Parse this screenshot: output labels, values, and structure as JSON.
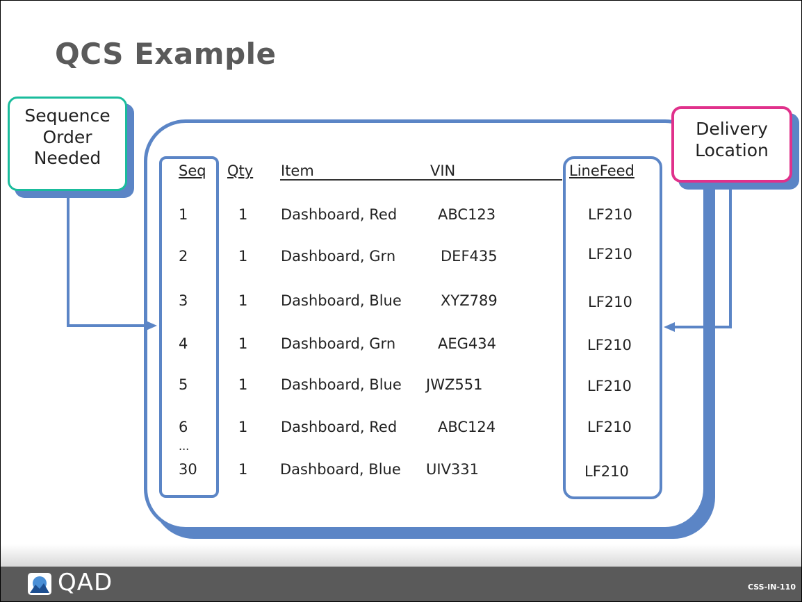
{
  "slide": {
    "title": "QCS Example",
    "callouts": {
      "sequence": [
        "Sequence",
        "Order",
        "Needed"
      ],
      "delivery": [
        "Delivery",
        "Location"
      ]
    },
    "table": {
      "headers": {
        "seq": "Seq",
        "qty": "Qty",
        "item": "Item",
        "vin": "VIN",
        "linefeed": "LineFeed"
      },
      "rows": [
        {
          "seq": "1",
          "qty": "1",
          "item": "Dashboard, Red",
          "vin": "ABC123",
          "linefeed": "LF210"
        },
        {
          "seq": "2",
          "qty": "1",
          "item": "Dashboard, Grn",
          "vin": "DEF435",
          "linefeed": "LF210"
        },
        {
          "seq": "3",
          "qty": "1",
          "item": "Dashboard, Blue",
          "vin": "XYZ789",
          "linefeed": "LF210"
        },
        {
          "seq": "4",
          "qty": "1",
          "item": "Dashboard, Grn",
          "vin": "AEG434",
          "linefeed": "LF210"
        },
        {
          "seq": "5",
          "qty": "1",
          "item": "Dashboard, Blue",
          "vin": "JWZ551",
          "linefeed": "LF210"
        },
        {
          "seq": "6",
          "qty": "1",
          "item": "Dashboard, Red",
          "vin": "ABC124",
          "linefeed": "LF210"
        },
        {
          "seq": "30",
          "qty": "1",
          "item": "Dashboard, Blue",
          "vin": "UIV331",
          "linefeed": "LF210"
        }
      ],
      "ellipsis": "..."
    },
    "footer": {
      "logo": "QAD",
      "code": "CSS-IN-110"
    },
    "colors": {
      "accent": "#5b85c6",
      "seq_callout_border": "#1abc9c",
      "delivery_callout_border": "#e0318b",
      "title": "#5a5a5a",
      "footer": "#5a5a5a"
    }
  }
}
